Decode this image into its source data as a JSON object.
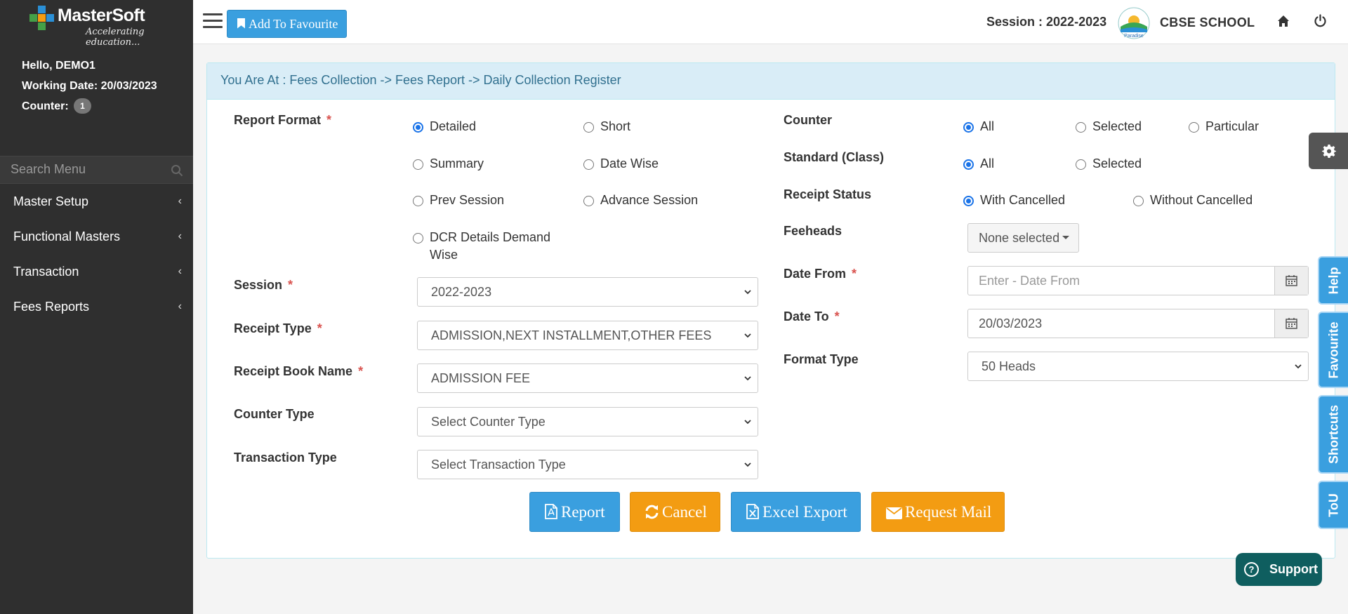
{
  "brand": {
    "name": "MasterSoft",
    "tagline": "Accelerating education..."
  },
  "user": {
    "greeting": "Hello, DEMO1",
    "working_date": "Working Date: 20/03/2023",
    "counter_label": "Counter:",
    "counter_value": "1"
  },
  "sidebar": {
    "search_placeholder": "Search Menu",
    "items": [
      {
        "label": "Master Setup"
      },
      {
        "label": "Functional Masters"
      },
      {
        "label": "Transaction"
      },
      {
        "label": "Fees Reports"
      }
    ]
  },
  "topbar": {
    "favourite_label": "Add To Favourite",
    "session": "Session : 2022-2023",
    "school_logo_text": "Paradise",
    "school_name": "CBSE SCHOOL"
  },
  "breadcrumb": "You Are At : Fees Collection -> Fees Report -> Daily Collection Register",
  "form": {
    "report_format": {
      "label": "Report Format",
      "options": [
        "Detailed",
        "Short",
        "Summary",
        "Date Wise",
        "Prev Session",
        "Advance Session",
        "DCR Details Demand Wise"
      ],
      "selected": "Detailed"
    },
    "session": {
      "label": "Session",
      "value": "2022-2023"
    },
    "receipt_type": {
      "label": "Receipt Type",
      "value": "ADMISSION,NEXT INSTALLMENT,OTHER FEES"
    },
    "receipt_book": {
      "label": "Receipt Book Name",
      "value": "ADMISSION FEE"
    },
    "counter_type": {
      "label": "Counter Type",
      "value": "Select Counter Type"
    },
    "transaction_type": {
      "label": "Transaction Type",
      "value": "Select Transaction Type"
    },
    "counter": {
      "label": "Counter",
      "options": [
        "All",
        "Selected",
        "Particular"
      ],
      "selected": "All"
    },
    "standard": {
      "label": "Standard (Class)",
      "options": [
        "All",
        "Selected"
      ],
      "selected": "All"
    },
    "receipt_status": {
      "label": "Receipt Status",
      "options": [
        "With Cancelled",
        "Without Cancelled"
      ],
      "selected": "With Cancelled"
    },
    "feeheads": {
      "label": "Feeheads",
      "value": "None selected"
    },
    "date_from": {
      "label": "Date From",
      "placeholder": "Enter - Date From",
      "value": ""
    },
    "date_to": {
      "label": "Date To",
      "value": "20/03/2023"
    },
    "format_type": {
      "label": "Format Type",
      "value": "50 Heads"
    },
    "required_mark": "*"
  },
  "actions": {
    "report": "Report",
    "cancel": "Cancel",
    "excel": "Excel Export",
    "mail": "Request Mail"
  },
  "side_tabs": [
    "Help",
    "Favourite",
    "Shortcuts",
    "ToU"
  ],
  "support": "Support",
  "colors": {
    "primary": "#3a9fdf",
    "warning": "#f39c12",
    "sidebar": "#2f2f2f",
    "support": "#0f5e5f",
    "breadcrumb_bg": "#d9edf7"
  }
}
